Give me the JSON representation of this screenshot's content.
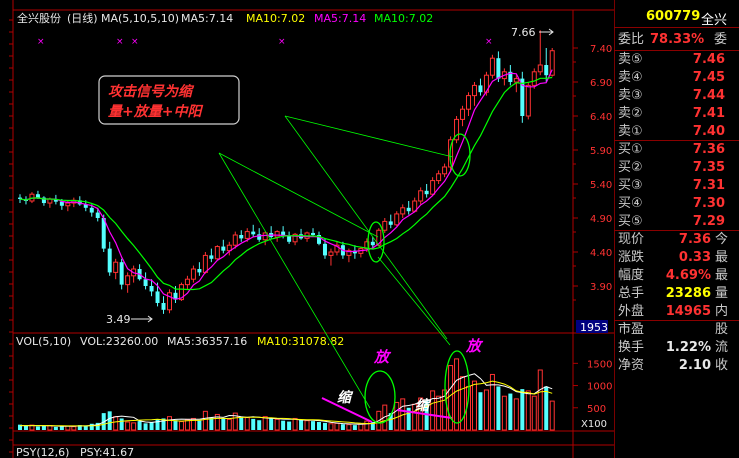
{
  "header": {
    "stock_name": "全兴股份",
    "period": "(日线)",
    "ma_title": "MA(5,10,5,10)",
    "ma5": "MA5:7.14",
    "ma10": "MA10:7.02",
    "ma5b": "MA5:7.14",
    "ma10b": "MA10:7.02"
  },
  "colors": {
    "up": "#ff3232",
    "down": "#54ffff",
    "ma5": "#ff00ff",
    "ma10": "#00ff00",
    "axis": "#b00000",
    "label_red": "#ff3232"
  },
  "annotation_box": {
    "line1": "攻击信号为缩",
    "line2": "量+放量+中阳"
  },
  "labels": {
    "high": "7.66",
    "low": "3.49",
    "fang1": "放",
    "fang2": "放",
    "suo1": "缩",
    "suo2": "缩",
    "date_tag": "1953",
    "vol_mult": "X100"
  },
  "vol_header": {
    "title": "VOL(5,10)",
    "vol": "VOL:23260.00",
    "ma5": "MA5:36357.16",
    "ma10": "MA10:31078.82"
  },
  "bottom_indicator": {
    "psy": "PSY(12,6)",
    "value": "PSY:41.67"
  },
  "price_axis": [
    "7.40",
    "6.90",
    "6.40",
    "5.90",
    "5.40",
    "4.90",
    "4.40",
    "3.90"
  ],
  "vol_axis": [
    "1500",
    "1000",
    "500"
  ],
  "quote": {
    "code": "600779",
    "name_short": "全兴",
    "ratio_label": "委比",
    "ratio_value": "78.33%",
    "ratio_extra": "委",
    "asks": [
      {
        "label": "卖⑤",
        "price": "7.46"
      },
      {
        "label": "卖④",
        "price": "7.45"
      },
      {
        "label": "卖③",
        "price": "7.44"
      },
      {
        "label": "卖②",
        "price": "7.41"
      },
      {
        "label": "卖①",
        "price": "7.40"
      }
    ],
    "bids": [
      {
        "label": "买①",
        "price": "7.36"
      },
      {
        "label": "买②",
        "price": "7.35"
      },
      {
        "label": "买③",
        "price": "7.31"
      },
      {
        "label": "买④",
        "price": "7.30"
      },
      {
        "label": "买⑤",
        "price": "7.29"
      }
    ],
    "stats": [
      {
        "label": "现价",
        "value": "7.36",
        "extra": "今",
        "color": "red"
      },
      {
        "label": "涨跌",
        "value": "0.33",
        "extra": "最",
        "color": "red"
      },
      {
        "label": "幅度",
        "value": "4.69%",
        "extra": "最",
        "color": "red"
      },
      {
        "label": "总手",
        "value": "23286",
        "extra": "量",
        "color": "yel"
      },
      {
        "label": "外盘",
        "value": "14965",
        "extra": "内",
        "color": "red"
      }
    ],
    "stats2": [
      {
        "label": "市盈",
        "value": "",
        "extra": "股",
        "color": "wht"
      },
      {
        "label": "换手",
        "value": "1.22%",
        "extra": "流",
        "color": "wht"
      },
      {
        "label": "净资",
        "value": "2.10",
        "extra": "收",
        "color": "wht"
      }
    ]
  },
  "chart_data": {
    "type": "candlestick",
    "price_range": [
      3.3,
      7.8
    ],
    "volume_range": [
      0,
      1800
    ],
    "candles": [
      [
        5.2,
        5.25,
        5.12,
        5.18
      ],
      [
        5.18,
        5.22,
        5.1,
        5.15
      ],
      [
        5.15,
        5.28,
        5.12,
        5.25
      ],
      [
        5.25,
        5.3,
        5.18,
        5.2
      ],
      [
        5.2,
        5.22,
        5.08,
        5.12
      ],
      [
        5.12,
        5.2,
        5.05,
        5.18
      ],
      [
        5.18,
        5.24,
        5.1,
        5.14
      ],
      [
        5.14,
        5.18,
        5.02,
        5.08
      ],
      [
        5.08,
        5.15,
        5.0,
        5.12
      ],
      [
        5.12,
        5.2,
        5.06,
        5.16
      ],
      [
        5.16,
        5.22,
        5.08,
        5.1
      ],
      [
        5.1,
        5.16,
        5.0,
        5.05
      ],
      [
        5.05,
        5.1,
        4.92,
        4.98
      ],
      [
        4.98,
        5.05,
        4.85,
        4.9
      ],
      [
        4.9,
        4.95,
        4.4,
        4.45
      ],
      [
        4.45,
        4.55,
        4.05,
        4.1
      ],
      [
        4.1,
        4.3,
        4.0,
        4.25
      ],
      [
        4.25,
        4.3,
        3.85,
        3.92
      ],
      [
        3.92,
        4.1,
        3.8,
        4.05
      ],
      [
        4.05,
        4.2,
        3.95,
        4.15
      ],
      [
        4.15,
        4.22,
        3.98,
        4.0
      ],
      [
        4.0,
        4.1,
        3.85,
        3.9
      ],
      [
        3.9,
        4.0,
        3.75,
        3.82
      ],
      [
        3.82,
        3.95,
        3.6,
        3.65
      ],
      [
        3.65,
        3.75,
        3.49,
        3.55
      ],
      [
        3.55,
        3.85,
        3.5,
        3.8
      ],
      [
        3.8,
        3.9,
        3.65,
        3.7
      ],
      [
        3.7,
        3.95,
        3.68,
        3.92
      ],
      [
        3.92,
        4.05,
        3.85,
        4.0
      ],
      [
        4.0,
        4.2,
        3.95,
        4.15
      ],
      [
        4.15,
        4.25,
        4.05,
        4.1
      ],
      [
        4.1,
        4.4,
        4.08,
        4.35
      ],
      [
        4.35,
        4.45,
        4.25,
        4.3
      ],
      [
        4.3,
        4.5,
        4.28,
        4.48
      ],
      [
        4.48,
        4.58,
        4.38,
        4.42
      ],
      [
        4.42,
        4.55,
        4.35,
        4.5
      ],
      [
        4.5,
        4.7,
        4.45,
        4.65
      ],
      [
        4.65,
        4.72,
        4.55,
        4.6
      ],
      [
        4.6,
        4.75,
        4.55,
        4.7
      ],
      [
        4.7,
        4.8,
        4.62,
        4.66
      ],
      [
        4.66,
        4.75,
        4.55,
        4.58
      ],
      [
        4.58,
        4.7,
        4.5,
        4.68
      ],
      [
        4.68,
        4.78,
        4.6,
        4.62
      ],
      [
        4.62,
        4.72,
        4.55,
        4.7
      ],
      [
        4.7,
        4.78,
        4.6,
        4.64
      ],
      [
        4.64,
        4.7,
        4.52,
        4.55
      ],
      [
        4.55,
        4.68,
        4.5,
        4.66
      ],
      [
        4.66,
        4.74,
        4.58,
        4.6
      ],
      [
        4.6,
        4.7,
        4.55,
        4.68
      ],
      [
        4.68,
        4.75,
        4.62,
        4.65
      ],
      [
        4.65,
        4.7,
        4.5,
        4.52
      ],
      [
        4.52,
        4.6,
        4.3,
        4.35
      ],
      [
        4.35,
        4.45,
        4.2,
        4.4
      ],
      [
        4.4,
        4.55,
        4.35,
        4.5
      ],
      [
        4.5,
        4.55,
        4.3,
        4.35
      ],
      [
        4.35,
        4.45,
        4.25,
        4.42
      ],
      [
        4.42,
        4.5,
        4.3,
        4.38
      ],
      [
        4.38,
        4.48,
        4.32,
        4.45
      ],
      [
        4.45,
        4.6,
        4.4,
        4.55
      ],
      [
        4.55,
        4.62,
        4.45,
        4.5
      ],
      [
        4.5,
        4.75,
        4.48,
        4.72
      ],
      [
        4.72,
        4.9,
        4.68,
        4.85
      ],
      [
        4.85,
        4.95,
        4.75,
        4.8
      ],
      [
        4.8,
        5.0,
        4.78,
        4.96
      ],
      [
        4.96,
        5.1,
        4.9,
        5.05
      ],
      [
        5.05,
        5.15,
        4.95,
        5.0
      ],
      [
        5.0,
        5.2,
        4.98,
        5.15
      ],
      [
        5.15,
        5.35,
        5.1,
        5.3
      ],
      [
        5.3,
        5.4,
        5.2,
        5.25
      ],
      [
        5.25,
        5.5,
        5.22,
        5.45
      ],
      [
        5.45,
        5.6,
        5.4,
        5.55
      ],
      [
        5.55,
        5.7,
        5.5,
        5.65
      ],
      [
        5.65,
        6.1,
        5.6,
        6.05
      ],
      [
        6.05,
        6.4,
        6.0,
        6.35
      ],
      [
        6.35,
        6.55,
        6.25,
        6.5
      ],
      [
        6.5,
        6.75,
        6.4,
        6.7
      ],
      [
        6.7,
        6.9,
        6.55,
        6.85
      ],
      [
        6.85,
        6.95,
        6.7,
        6.75
      ],
      [
        6.75,
        7.05,
        6.7,
        7.0
      ],
      [
        7.0,
        7.3,
        6.95,
        7.25
      ],
      [
        7.25,
        7.35,
        6.9,
        6.95
      ],
      [
        6.95,
        7.1,
        6.85,
        7.05
      ],
      [
        7.05,
        7.15,
        6.85,
        6.9
      ],
      [
        6.9,
        7.0,
        6.75,
        6.95
      ],
      [
        6.95,
        7.05,
        6.3,
        6.4
      ],
      [
        6.4,
        6.9,
        6.35,
        6.85
      ],
      [
        6.85,
        7.1,
        6.8,
        7.05
      ],
      [
        7.05,
        7.66,
        7.0,
        7.15
      ],
      [
        7.15,
        7.4,
        6.9,
        7.0
      ],
      [
        7.0,
        7.4,
        6.98,
        7.36
      ]
    ],
    "volumes": [
      120,
      90,
      110,
      80,
      95,
      100,
      70,
      85,
      90,
      75,
      110,
      95,
      140,
      160,
      380,
      420,
      300,
      260,
      180,
      160,
      200,
      150,
      170,
      240,
      260,
      300,
      220,
      190,
      230,
      260,
      210,
      420,
      280,
      350,
      260,
      240,
      380,
      300,
      280,
      250,
      220,
      300,
      260,
      240,
      210,
      190,
      260,
      230,
      210,
      200,
      180,
      160,
      140,
      150,
      130,
      120,
      110,
      140,
      200,
      180,
      420,
      560,
      380,
      620,
      700,
      500,
      580,
      720,
      650,
      880,
      760,
      900,
      1450,
      1600,
      1200,
      980,
      1100,
      850,
      900,
      1250,
      980,
      760,
      820,
      700,
      920,
      880,
      760,
      1350,
      980,
      650
    ],
    "volume_ma5": [
      100,
      100,
      100,
      99,
      99,
      95,
      91,
      86,
      88,
      84,
      92,
      93,
      104,
      115,
      179,
      261,
      300,
      312,
      300,
      286,
      204,
      180,
      170,
      184,
      205,
      226,
      238,
      246,
      242,
      240,
      244,
      266,
      282,
      294,
      284,
      326,
      322,
      300,
      284,
      298,
      286,
      270,
      262,
      256,
      246,
      240,
      240,
      226,
      222,
      218,
      212,
      198,
      172,
      158,
      144,
      138,
      132,
      128,
      138,
      148,
      210,
      296,
      344,
      436,
      536,
      552,
      580,
      640,
      650,
      706,
      716,
      762,
      940,
      1118,
      1182,
      1226,
      1264,
      1156,
      1006,
      1016,
      1014,
      988,
      940,
      862,
      842,
      816,
      816,
      908,
      978,
      928
    ],
    "volume_ma10": [
      100,
      100,
      100,
      100,
      99,
      98,
      96,
      94,
      93,
      92,
      93,
      93,
      96,
      100,
      129,
      164,
      183,
      199,
      208,
      213,
      222,
      228,
      232,
      240,
      228,
      216,
      208,
      201,
      206,
      216,
      217,
      238,
      249,
      261,
      262,
      256,
      272,
      283,
      288,
      288,
      289,
      277,
      275,
      265,
      260,
      256,
      244,
      237,
      230,
      232,
      228,
      214,
      202,
      193,
      183,
      174,
      159,
      150,
      147,
      145,
      169,
      211,
      235,
      283,
      340,
      378,
      425,
      483,
      528,
      603,
      637,
      671,
      778,
      876,
      926,
      974,
      1026,
      1039,
      1064,
      1101,
      1072,
      1032,
      970,
      880,
      852,
      842,
      808,
      858,
      868,
      825
    ]
  }
}
